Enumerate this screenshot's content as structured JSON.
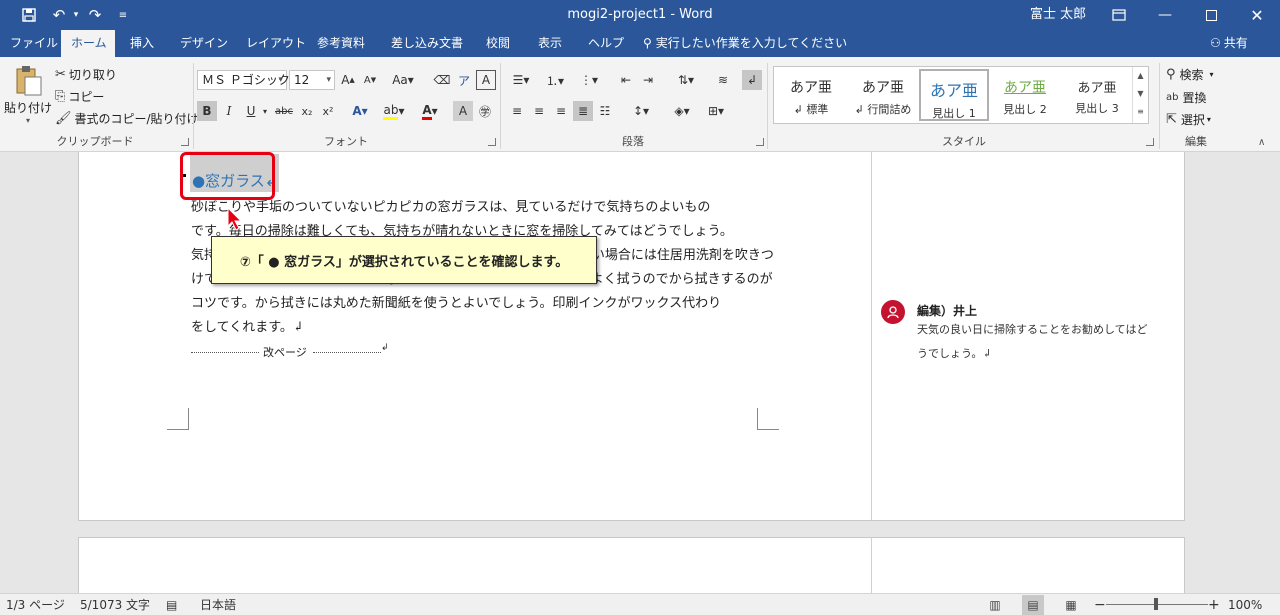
{
  "titlebar": {
    "title": "mogi2-project1  -  Word",
    "user": "富士 太郎",
    "save_icon": "save-icon",
    "undo_icon": "undo-icon",
    "redo_icon": "redo-icon",
    "customize_icon": "customize-qat-icon"
  },
  "tabs": [
    "ファイル",
    "ホーム",
    "挿入",
    "デザイン",
    "レイアウト",
    "参考資料",
    "差し込み文書",
    "校閲",
    "表示",
    "ヘルプ"
  ],
  "tellme": "実行したい作業を入力してください",
  "share": "共有",
  "ribbon": {
    "clipboard": {
      "label": "クリップボード",
      "paste": "貼り付け",
      "cut": "切り取り",
      "copy": "コピー",
      "format_painter": "書式のコピー/貼り付け"
    },
    "font": {
      "label": "フォント",
      "name": "ＭＳ Ｐゴシック",
      "size": "12"
    },
    "paragraph": {
      "label": "段落"
    },
    "styles": {
      "label": "スタイル",
      "items": [
        {
          "sample": "あア亜",
          "name": "↲ 標準"
        },
        {
          "sample": "あア亜",
          "name": "↲ 行間詰め"
        },
        {
          "sample": "あア亜",
          "name": "見出し 1"
        },
        {
          "sample": "あア亜",
          "name": "見出し 2"
        },
        {
          "sample": "あア亜",
          "name": "見出し 3"
        }
      ]
    },
    "editing": {
      "label": "編集",
      "find": "検索",
      "replace": "置換",
      "select": "選択"
    }
  },
  "document": {
    "heading": "●窓ガラス↲",
    "body_lines": [
      "砂ぼこりや手垢のついていないピカピカの窓ガラスは、見ているだけで気持ちのよいもの",
      "です。毎日の掃除は難しくても、気持ちが晴れないときに窓を掃除してみてはどうでしょう。",
      "気持ちよく掃除するためにも、まずは汚れを落とします。汚れがひどい場合には住居用洗剤を吹きつ",
      "けてしばらく置いておき、汚れが浮いてくるのを待ってから、汚れをよく拭うのでから拭きするのが",
      "コツです。から拭きには丸めた新聞紙を使うとよいでしょう。印刷インクがワックス代わり",
      "をしてくれます。↲"
    ],
    "page_break": "改ページ"
  },
  "tooltip": "⑦「 ● 窓ガラス」が選択されていることを確認します。",
  "comment": {
    "author": "編集）井上",
    "lines": [
      "天気の良い日に掃除することをお勧めしてはど",
      "うでしょう。↲"
    ]
  },
  "status": {
    "page": "1/3 ページ",
    "words": "5/1073 文字",
    "language": "日本語",
    "zoom": "100%",
    "zoom_value": 100
  },
  "colors": {
    "titlebar": "#2b579a",
    "heading": "#2e74b5",
    "callout": "#e60012",
    "tooltip_bg": "#ffffcc",
    "avatar": "#c4122f"
  }
}
